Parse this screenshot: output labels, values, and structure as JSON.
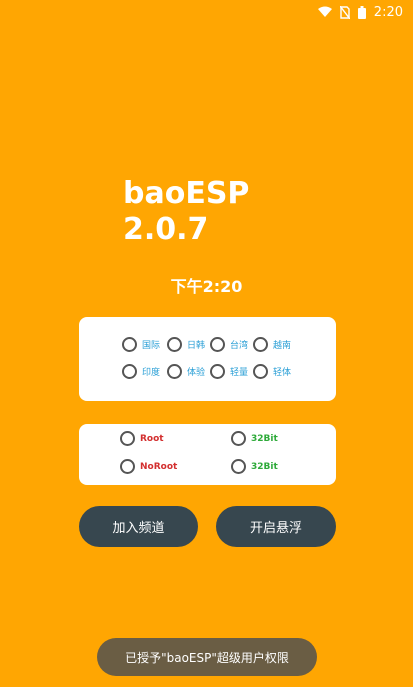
{
  "status_bar": {
    "time": "2:20",
    "icons": [
      "wifi-icon",
      "no-sim-icon",
      "battery-icon"
    ]
  },
  "app": {
    "name": "baoESP",
    "version": "2.0.7",
    "clock": "下午2:20"
  },
  "region_card": {
    "options": [
      {
        "label": "国际"
      },
      {
        "label": "日韩"
      },
      {
        "label": "台湾"
      },
      {
        "label": "越南"
      },
      {
        "label": "印度"
      },
      {
        "label": "体验"
      },
      {
        "label": "轻量"
      },
      {
        "label": "轻体"
      }
    ]
  },
  "mode_card": {
    "root": "Root",
    "noroot": "NoRoot",
    "bit_a": "32Bit",
    "bit_b": "32Bit"
  },
  "buttons": {
    "join_channel": "加入频道",
    "open_float": "开启悬浮"
  },
  "toast": {
    "message": "已授予\"baoESP\"超级用户权限"
  },
  "colors": {
    "background": "#FFA602",
    "button": "#37474F",
    "region_label": "#2A9FD6",
    "root_label": "#D32F2F",
    "bit_label": "#2EAA3A"
  }
}
